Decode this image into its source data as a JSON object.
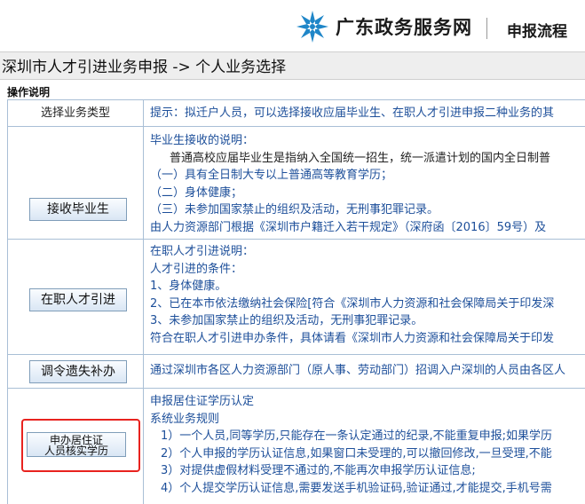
{
  "header": {
    "brand": "广东政务服务网",
    "flow": "申报流程"
  },
  "breadcrumb": "深圳市人才引进业务申报 -> 个人业务选择",
  "section_label": "操作说明",
  "table": {
    "header_left": "选择业务类型",
    "header_right": "提示：拟迁户人员，可以选择接收应届毕业生、在职人才引进申报二种业务的其",
    "rows": [
      {
        "button": "接收毕业生",
        "lines": [
          "毕业生接收的说明：",
          "普通高校应届毕业生是指纳入全国统一招生，统一派遣计划的国内全日制普",
          "（一）具有全日制大专以上普通高等教育学历；",
          "（二）身体健康；",
          "（三）未参加国家禁止的组织及活动，无刑事犯罪记录。",
          "由人力资源部门根据《深圳市户籍迁入若干规定》（深府函〔2016〕59号）及"
        ]
      },
      {
        "button": "在职人才引进",
        "lines": [
          "在职人才引进说明：",
          "人才引进的条件：",
          "1、身体健康。",
          "2、已在本市依法缴纳社会保险[符合《深圳市人力资源和社会保障局关于印发深",
          "3、未参加国家禁止的组织及活动，无刑事犯罪记录。",
          "符合在职人才引进申办条件，具体请看《深圳市人力资源和社会保障局关于印发"
        ]
      },
      {
        "button": "调令遗失补办",
        "lines": [
          "通过深圳市各区人力资源部门（原人事、劳动部门）招调入户深圳的人员由各区人"
        ]
      },
      {
        "button_line1": "申办居住证",
        "button_line2": "人员核实学历",
        "lines": [
          "申报居住证学历认定",
          "系统业务规则",
          "1）一个人员,同等学历,只能存在一条认定通过的纪录,不能重复申报;如果学历",
          "2）个人申报的学历认证信息,如果窗口未受理的,可以撤回修改,一旦受理,不能",
          "3）对提供虚假材料受理不通过的,不能再次申报学历认证信息;",
          "4）个人提交学历认证信息,需要发送手机验证码,验证通过,才能提交,手机号需"
        ]
      }
    ]
  },
  "colors": {
    "accent_text": "#1d4f9a",
    "border": "#a9bfd6",
    "highlight": "#e8231f",
    "logo": "#1f86c8"
  }
}
